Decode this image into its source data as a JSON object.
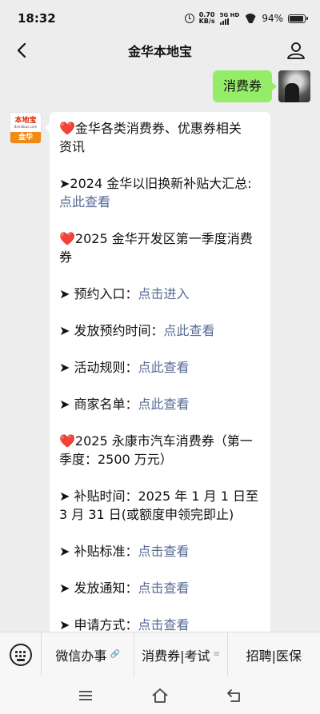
{
  "status_bar": {
    "time": "18:32",
    "net_speed_value": "0.70",
    "net_speed_unit": "KB/s",
    "network_label": "5G HD",
    "battery": "94%",
    "battery_level": 0.94
  },
  "header": {
    "title": "金华本地宝",
    "back_icon": "chevron-left-icon",
    "profile_icon": "user-icon"
  },
  "chat": {
    "my_message": "消费券",
    "bot_avatar": {
      "logo_text": "本地宝",
      "logo_subtext": "Bendibao.com",
      "band_text": "金华"
    },
    "bot_message": {
      "block1_line1": "❤️金华各类消费券、优惠券相关",
      "block1_line2": "资讯",
      "block2_prefix": "➤2024 金华以旧换新补贴大汇总:",
      "block2_link": "点此查看",
      "block3_line1": "❤️2025 金华开发区第一季度消费",
      "block3_line2": "券",
      "item1_label": "➤ 预约入口：",
      "item1_link": "点击进入",
      "item2_label": "➤ 发放预约时间：",
      "item2_link": "点此查看",
      "item3_label": "➤ 活动规则：",
      "item3_link": "点此查看",
      "item4_label": "➤ 商家名单：",
      "item4_link": "点此查看",
      "block4_line1": "❤️2025 永康市汽车消费券（第一",
      "block4_line2": "季度：2500 万元）",
      "item5_line1": "➤ 补贴时间：2025 年 1 月 1 日至",
      "item5_line2": "3 月 31 日(或额度申领完即止)",
      "item6_label": "➤ 补贴标准：",
      "item6_link": "点击查看",
      "item7_label": "➤ 发放通知：",
      "item7_link": "点击查看",
      "item8_label": "➤ 申请方式：",
      "item8_link": "点击查看"
    }
  },
  "bottom_menu": {
    "keyboard_icon": "keyboard-icon",
    "items": [
      {
        "label": "微信办事",
        "icon": "link-icon"
      },
      {
        "label": "消费券|考试",
        "icon": "menu-icon"
      },
      {
        "label": "招聘|医保",
        "icon": "menu-icon"
      }
    ]
  },
  "nav_bar": {
    "icons": [
      "menu-icon",
      "home-icon",
      "back-icon"
    ]
  },
  "colors": {
    "background": "#ededed",
    "my_bubble": "#95ec69",
    "link": "#576b95",
    "logo_red": "#d9290b",
    "logo_orange": "#f08a12"
  }
}
